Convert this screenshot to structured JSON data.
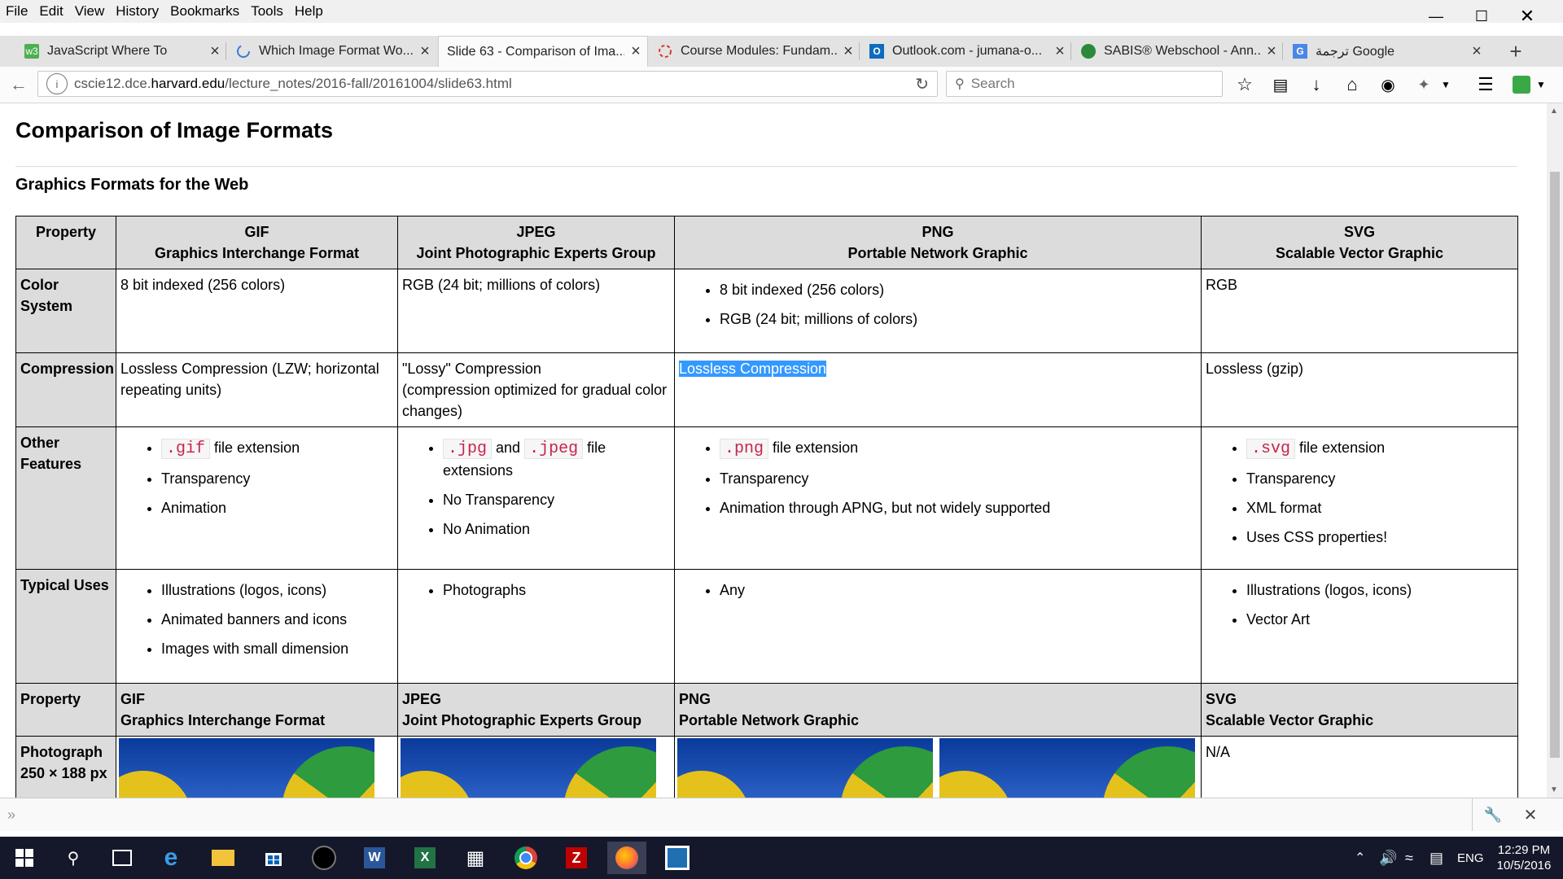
{
  "menubar": {
    "items": [
      "File",
      "Edit",
      "View",
      "History",
      "Bookmarks",
      "Tools",
      "Help"
    ]
  },
  "tabs": [
    {
      "title": "JavaScript Where To",
      "icon": "w3schools-icon",
      "active": false
    },
    {
      "title": "Which Image Format Wo...",
      "icon": "loading-icon",
      "active": false
    },
    {
      "title": "Slide 63 - Comparison of Ima...",
      "icon": "",
      "active": true
    },
    {
      "title": "Course Modules: Fundam...",
      "icon": "loading-icon",
      "active": false
    },
    {
      "title": "Outlook.com - jumana-o...",
      "icon": "outlook-icon",
      "active": false
    },
    {
      "title": "SABIS® Webschool - Ann...",
      "icon": "sabis-icon",
      "active": false
    },
    {
      "title": "ترجمة Google",
      "icon": "google-translate-icon",
      "active": false
    }
  ],
  "nav": {
    "url_prefix": "cscie12.dce.",
    "url_domain": "harvard.edu",
    "url_path": "/lecture_notes/2016-fall/20161004/slide63.html",
    "search_placeholder": "Search"
  },
  "page": {
    "title": "Comparison of Image Formats",
    "subtitle": "Graphics Formats for the Web",
    "header": {
      "property": "Property",
      "formats": [
        {
          "code": "GIF",
          "name": "Graphics Interchange Format"
        },
        {
          "code": "JPEG",
          "name": "Joint Photographic Experts Group"
        },
        {
          "code": "PNG",
          "name": "Portable Network Graphic"
        },
        {
          "code": "SVG",
          "name": "Scalable Vector Graphic"
        }
      ]
    },
    "color_system": {
      "label": "Color System",
      "gif": "8 bit indexed (256 colors)",
      "jpeg": "RGB (24 bit; millions of colors)",
      "png": [
        "8 bit indexed (256 colors)",
        "RGB (24 bit; millions of colors)"
      ],
      "svg": "RGB"
    },
    "compression": {
      "label": "Compression",
      "gif": "Lossless Compression (LZW; horizontal repeating units)",
      "jpeg_line1": "\"Lossy\" Compression",
      "jpeg_line2": "(compression optimized for gradual color changes)",
      "png": "Lossless Compression",
      "svg": "Lossless (gzip)"
    },
    "other_features": {
      "label_line1": "Other",
      "label_line2": "Features",
      "gif_code": ".gif",
      "gif_ext": "file extension",
      "gif_items": [
        "Transparency",
        "Animation"
      ],
      "jpeg_code1": ".jpg",
      "jpeg_and": "and",
      "jpeg_code2": ".jpeg",
      "jpeg_ext": "file extensions",
      "jpeg_items": [
        "No Transparency",
        "No Animation"
      ],
      "png_code": ".png",
      "png_ext": "file extension",
      "png_items": [
        "Transparency",
        "Animation through APNG, but not widely supported"
      ],
      "svg_code": ".svg",
      "svg_ext": "file extension",
      "svg_items": [
        "Transparency",
        "XML format",
        "Uses CSS properties!"
      ]
    },
    "typical_uses": {
      "label": "Typical Uses",
      "gif": [
        "Illustrations (logos, icons)",
        "Animated banners and icons",
        "Images with small dimension"
      ],
      "jpeg": [
        "Photographs"
      ],
      "png": [
        "Any"
      ],
      "svg": [
        "Illustrations (logos, icons)",
        "Vector Art"
      ]
    },
    "photo_row": {
      "label_line1": "Photograph",
      "label_line2": "250 × 188 px",
      "svg": "N/A"
    }
  },
  "taskbar": {
    "language": "ENG",
    "time": "12:29 PM",
    "date": "10/5/2016"
  }
}
